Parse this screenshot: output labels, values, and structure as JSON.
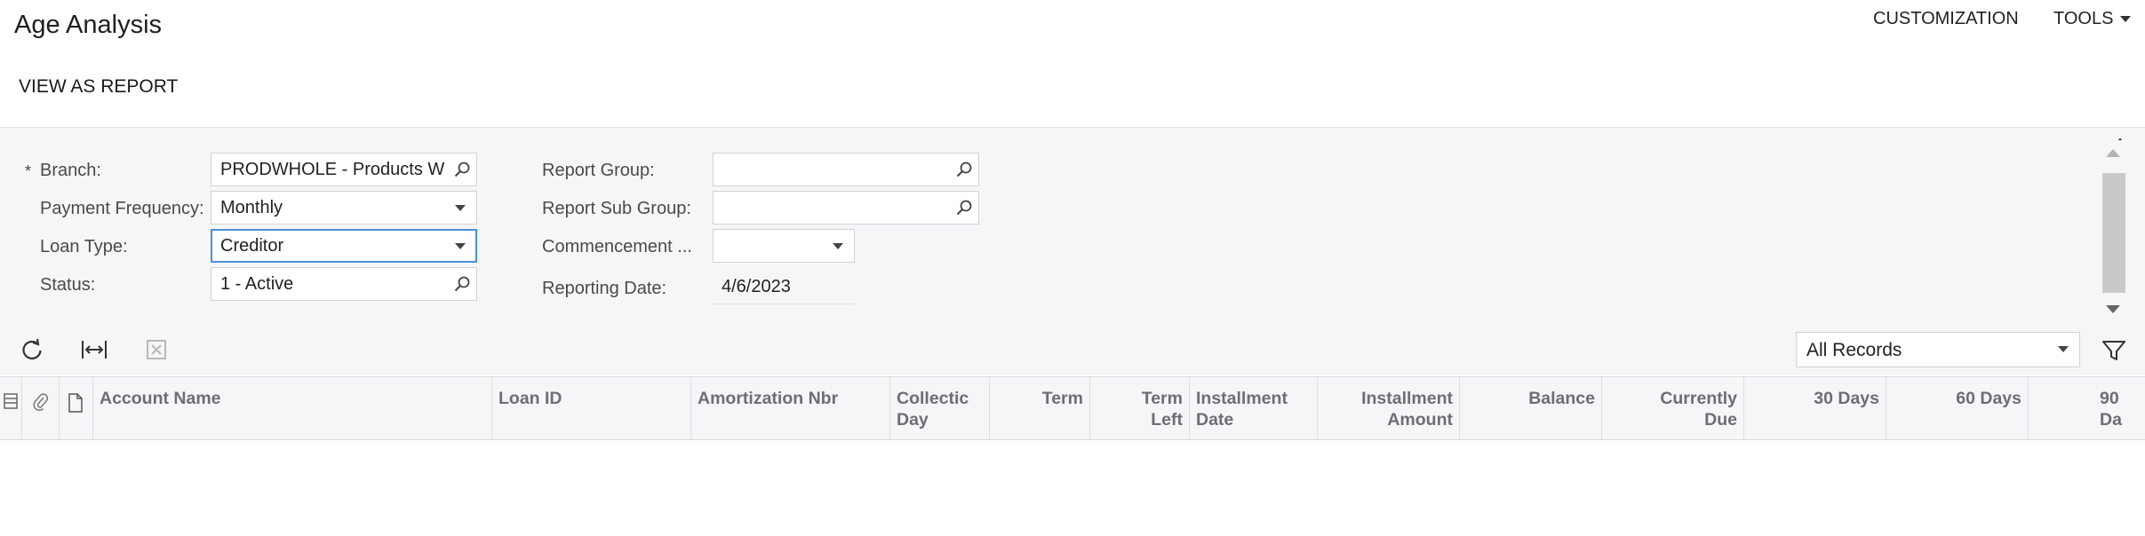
{
  "page": {
    "title": "Age Analysis"
  },
  "top_menu": {
    "customization": "CUSTOMIZATION",
    "tools": "TOOLS"
  },
  "toolbar": {
    "view_as_report": "VIEW AS REPORT"
  },
  "filters": {
    "branch_label": "Branch:",
    "branch_required_mark": "*",
    "branch_value": "PRODWHOLE - Products W",
    "payment_frequency_label": "Payment Frequency:",
    "payment_frequency_value": "Monthly",
    "loan_type_label": "Loan Type:",
    "loan_type_value": "Creditor",
    "status_label": "Status:",
    "status_value": "1 - Active",
    "report_group_label": "Report Group:",
    "report_group_value": "",
    "report_sub_group_label": "Report Sub Group:",
    "report_sub_group_value": "",
    "commencement_label": "Commencement ...",
    "commencement_value": "",
    "reporting_date_label": "Reporting Date:",
    "reporting_date_value": "4/6/2023"
  },
  "grid_toolbar": {
    "refresh_icon": "refresh-icon",
    "fit_columns_icon": "fit-columns-icon",
    "export_excel_icon": "excel-export-icon",
    "records_filter": "All Records",
    "filter_icon": "filter-icon"
  },
  "grid": {
    "columns": [
      "Account Name",
      "Loan ID",
      "Amortization Nbr",
      "Collectic\nDay",
      "Term",
      "Term\nLeft",
      "Installment\nDate",
      "Installment\nAmount",
      "Balance",
      "Currently\nDue",
      "30 Days",
      "60 Days",
      "90 Da"
    ],
    "rows": []
  },
  "colors": {
    "panel_bg": "#f5f6f7",
    "focus_border": "#4a90d9",
    "header_text": "#6b6f73"
  }
}
